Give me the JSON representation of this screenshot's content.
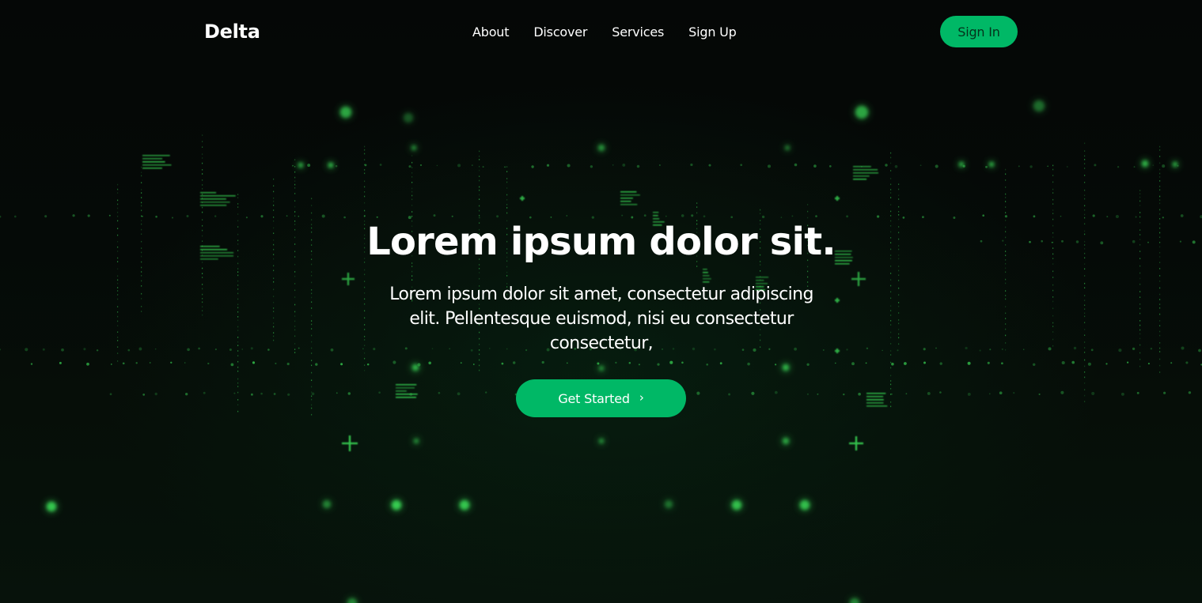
{
  "brand": {
    "name": "Delta",
    "accent_color": "#00b866",
    "glow_color": "#39d353"
  },
  "nav": {
    "items": [
      "About",
      "Discover",
      "Services",
      "Sign Up"
    ],
    "sign_in_label": "Sign In"
  },
  "hero": {
    "title": "Lorem ipsum dolor sit.",
    "subtitle": "Lorem ipsum dolor sit amet, consectetur adipiscing elit. Pellentesque euismod, nisi eu consectetur consectetur,",
    "cta_label": "Get Started",
    "cta_icon": "chevron-right-icon"
  },
  "background": {
    "description_icon": "matrix-grid-background"
  }
}
